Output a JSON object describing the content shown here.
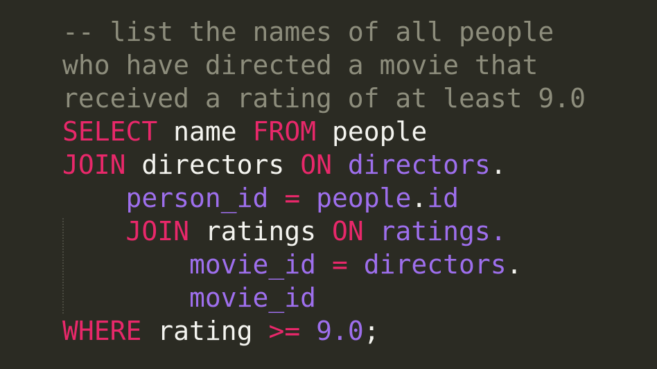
{
  "editor": {
    "background_color": "#2b2b23",
    "language": "sql",
    "font_size_px": 38,
    "line_height_px": 48,
    "palette": {
      "comment": "#8d8d7c",
      "keyword": "#e8286a",
      "operator": "#e8286a",
      "identifier": "#9e6fed",
      "number": "#9e6fed",
      "plain_text": "#f4f4ef",
      "indent_guide": "#4a4a40"
    },
    "indent_guide": {
      "visible": true,
      "column": 1
    }
  },
  "code": {
    "full_text": "-- list the names of all people\nwho have directed a movie that\nreceived a rating of at least 9.0\nSELECT name FROM people\nJOIN directors ON directors.\n    person_id = people.id\n    JOIN ratings ON ratings.\n        movie_id = directors.\n        movie_id\nWHERE rating >= 9.0;",
    "lines": [
      {
        "index": 0,
        "tokens": [
          {
            "t": "--",
            "k": "comment"
          },
          {
            "t": " ",
            "k": "space"
          },
          {
            "t": "list the names of all people",
            "k": "comment"
          }
        ]
      },
      {
        "index": 1,
        "tokens": [
          {
            "t": "who have directed a movie that",
            "k": "comment"
          }
        ]
      },
      {
        "index": 2,
        "tokens": [
          {
            "t": "received a rating of at least 9.0",
            "k": "comment"
          }
        ]
      },
      {
        "index": 3,
        "tokens": [
          {
            "t": "SELECT",
            "k": "keyword"
          },
          {
            "t": " ",
            "k": "space"
          },
          {
            "t": "name",
            "k": "plain"
          },
          {
            "t": " ",
            "k": "space"
          },
          {
            "t": "FROM",
            "k": "keyword"
          },
          {
            "t": " ",
            "k": "space"
          },
          {
            "t": "people",
            "k": "plain"
          }
        ]
      },
      {
        "index": 4,
        "tokens": [
          {
            "t": "JOIN",
            "k": "keyword"
          },
          {
            "t": " ",
            "k": "space"
          },
          {
            "t": "directors",
            "k": "plain"
          },
          {
            "t": " ",
            "k": "space"
          },
          {
            "t": "ON",
            "k": "keyword"
          },
          {
            "t": " ",
            "k": "space"
          },
          {
            "t": "directors",
            "k": "ident"
          },
          {
            "t": ".",
            "k": "punct"
          }
        ]
      },
      {
        "index": 5,
        "tokens": [
          {
            "t": "    ",
            "k": "space"
          },
          {
            "t": "person_id",
            "k": "ident"
          },
          {
            "t": " ",
            "k": "space"
          },
          {
            "t": "=",
            "k": "operator"
          },
          {
            "t": " ",
            "k": "space"
          },
          {
            "t": "people",
            "k": "ident"
          },
          {
            "t": ".",
            "k": "punct"
          },
          {
            "t": "id",
            "k": "ident"
          }
        ]
      },
      {
        "index": 6,
        "tokens": [
          {
            "t": "    ",
            "k": "space"
          },
          {
            "t": "JOIN",
            "k": "keyword"
          },
          {
            "t": " ",
            "k": "space"
          },
          {
            "t": "ratings",
            "k": "plain"
          },
          {
            "t": " ",
            "k": "space"
          },
          {
            "t": "ON",
            "k": "keyword"
          },
          {
            "t": " ",
            "k": "space"
          },
          {
            "t": "ratings",
            "k": "ident"
          },
          {
            "t": ".",
            "k": "punct-p"
          }
        ]
      },
      {
        "index": 7,
        "tokens": [
          {
            "t": "        ",
            "k": "space"
          },
          {
            "t": "movie_id",
            "k": "ident"
          },
          {
            "t": " ",
            "k": "space"
          },
          {
            "t": "=",
            "k": "operator"
          },
          {
            "t": " ",
            "k": "space"
          },
          {
            "t": "directors",
            "k": "ident"
          },
          {
            "t": ".",
            "k": "punct"
          }
        ]
      },
      {
        "index": 8,
        "tokens": [
          {
            "t": "        ",
            "k": "space"
          },
          {
            "t": "movie_id",
            "k": "ident"
          }
        ]
      },
      {
        "index": 9,
        "tokens": [
          {
            "t": "WHERE",
            "k": "keyword"
          },
          {
            "t": " ",
            "k": "space"
          },
          {
            "t": "rating",
            "k": "plain"
          },
          {
            "t": " ",
            "k": "space"
          },
          {
            "t": ">=",
            "k": "operator"
          },
          {
            "t": " ",
            "k": "space"
          },
          {
            "t": "9.0",
            "k": "number"
          },
          {
            "t": ";",
            "k": "punct"
          }
        ]
      }
    ]
  }
}
